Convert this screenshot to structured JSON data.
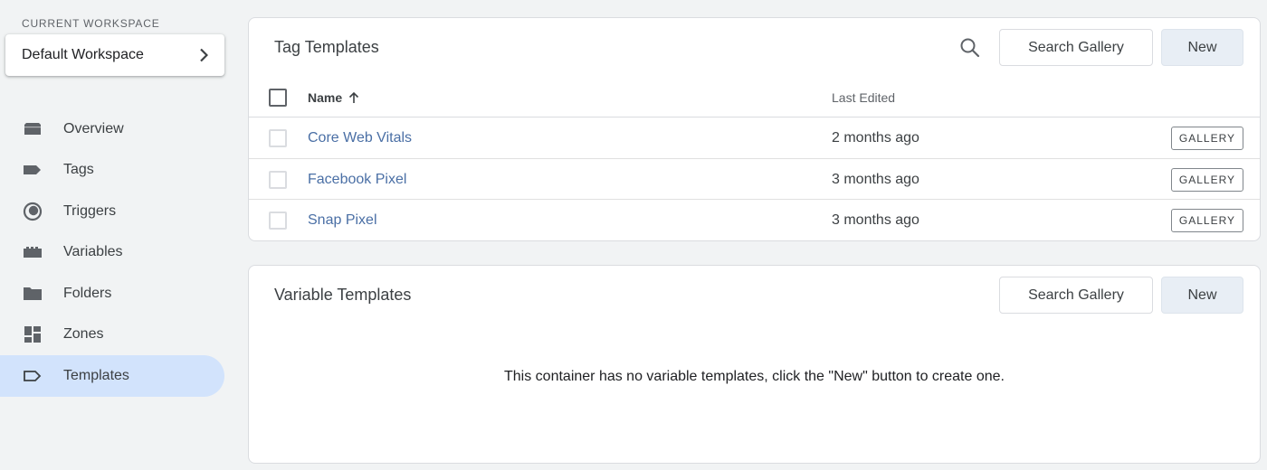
{
  "workspace": {
    "label": "CURRENT WORKSPACE",
    "name": "Default Workspace"
  },
  "sidebar": {
    "items": [
      {
        "label": "Overview",
        "icon": "overview-icon",
        "active": false
      },
      {
        "label": "Tags",
        "icon": "tag-icon",
        "active": false
      },
      {
        "label": "Triggers",
        "icon": "trigger-icon",
        "active": false
      },
      {
        "label": "Variables",
        "icon": "variables-icon",
        "active": false
      },
      {
        "label": "Folders",
        "icon": "folder-icon",
        "active": false
      },
      {
        "label": "Zones",
        "icon": "zones-icon",
        "active": false
      },
      {
        "label": "Templates",
        "icon": "template-icon",
        "active": true
      }
    ]
  },
  "tag_templates": {
    "title": "Tag Templates",
    "search_gallery": "Search Gallery",
    "new": "New",
    "columns": {
      "name": "Name",
      "last_edited": "Last Edited"
    },
    "rows": [
      {
        "name": "Core Web Vitals",
        "last_edited": "2 months ago",
        "badge": "GALLERY"
      },
      {
        "name": "Facebook Pixel",
        "last_edited": "3 months ago",
        "badge": "GALLERY"
      },
      {
        "name": "Snap Pixel",
        "last_edited": "3 months ago",
        "badge": "GALLERY"
      }
    ]
  },
  "variable_templates": {
    "title": "Variable Templates",
    "search_gallery": "Search Gallery",
    "new": "New",
    "empty_message": "This container has no variable templates, click the \"New\" button to create one."
  },
  "colors": {
    "background": "#f1f3f4",
    "active_nav": "#d2e3fc",
    "link": "#4a6fa5",
    "new_button": "#e8eef5"
  }
}
